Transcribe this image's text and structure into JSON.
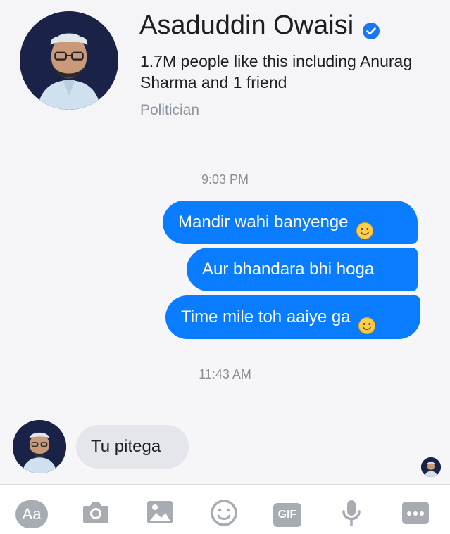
{
  "header": {
    "page_name": "Asaduddin Owaisi",
    "likes_text": "1.7M people like this including Anurag Sharma and 1 friend",
    "category": "Politician"
  },
  "conversation": {
    "timestamps": [
      "9:03 PM",
      "11:43 AM"
    ],
    "outgoing": [
      {
        "text": "Mandir wahi banyenge",
        "emoji": "slightly-smiling-face"
      },
      {
        "text": "Aur bhandara bhi hoga"
      },
      {
        "text": "Time mile toh aaiye ga",
        "emoji": "slightly-smiling-face"
      }
    ],
    "incoming": [
      {
        "text": "Tu pitega"
      }
    ]
  },
  "composer": {
    "aa_label": "Aa",
    "gif_label": "GIF",
    "icons": [
      "aa-icon",
      "camera-icon",
      "image-icon",
      "emoji-icon",
      "gif-icon",
      "microphone-icon",
      "more-icon"
    ]
  },
  "colors": {
    "outgoing_bubble": "#0a7cff",
    "incoming_bubble": "#e4e6eb",
    "verified": "#1877f2",
    "toolbar_icon": "#a7abb2"
  }
}
